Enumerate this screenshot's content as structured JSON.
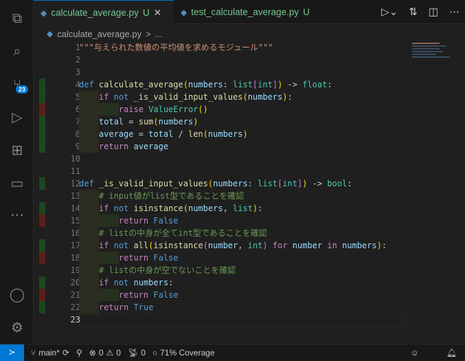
{
  "tabs": [
    {
      "label": "calculate_average.py",
      "status": "U",
      "active": true
    },
    {
      "label": "test_calculate_average.py",
      "status": "U",
      "active": false
    }
  ],
  "breadcrumb": {
    "file": "calculate_average.py",
    "sep": ">",
    "rest": "..."
  },
  "scm_badge": "23",
  "lines": [
    {
      "n": 1,
      "cov": "",
      "tokens": [
        [
          "\"\"\"与えられた数値の平均値を求めるモジュール\"\"\"",
          "s"
        ]
      ]
    },
    {
      "n": 2,
      "cov": "",
      "tokens": []
    },
    {
      "n": 3,
      "cov": "",
      "tokens": []
    },
    {
      "n": 4,
      "cov": "g",
      "tokens": [
        [
          "def ",
          "k"
        ],
        [
          "calculate_average",
          "f"
        ],
        [
          "(",
          "y"
        ],
        [
          "numbers",
          "v"
        ],
        [
          ": ",
          "p"
        ],
        [
          "list",
          "t"
        ],
        [
          "[",
          "pk"
        ],
        [
          "int",
          "t"
        ],
        [
          "]",
          "pk"
        ],
        [
          ")",
          "y"
        ],
        [
          " -> ",
          "p"
        ],
        [
          "float",
          "t"
        ],
        [
          ":",
          "p"
        ]
      ]
    },
    {
      "n": 5,
      "cov": "g",
      "tokens": [
        [
          "    ",
          "p"
        ],
        [
          "if ",
          "c"
        ],
        [
          "not ",
          "k"
        ],
        [
          "_is_valid_input_values",
          "f"
        ],
        [
          "(",
          "y"
        ],
        [
          "numbers",
          "v"
        ],
        [
          ")",
          "y"
        ],
        [
          ":",
          "p"
        ]
      ]
    },
    {
      "n": 6,
      "cov": "r",
      "tokens": [
        [
          "        ",
          "p"
        ],
        [
          "raise ",
          "c"
        ],
        [
          "ValueError",
          "t"
        ],
        [
          "()",
          "y"
        ]
      ]
    },
    {
      "n": 7,
      "cov": "g",
      "tokens": [
        [
          "    ",
          "p"
        ],
        [
          "total",
          "v"
        ],
        [
          " = ",
          "p"
        ],
        [
          "sum",
          "f"
        ],
        [
          "(",
          "y"
        ],
        [
          "numbers",
          "v"
        ],
        [
          ")",
          "y"
        ]
      ]
    },
    {
      "n": 8,
      "cov": "g",
      "tokens": [
        [
          "    ",
          "p"
        ],
        [
          "average",
          "v"
        ],
        [
          " = ",
          "p"
        ],
        [
          "total",
          "v"
        ],
        [
          " / ",
          "p"
        ],
        [
          "len",
          "f"
        ],
        [
          "(",
          "y"
        ],
        [
          "numbers",
          "v"
        ],
        [
          ")",
          "y"
        ]
      ]
    },
    {
      "n": 9,
      "cov": "g",
      "tokens": [
        [
          "    ",
          "p"
        ],
        [
          "return ",
          "c"
        ],
        [
          "average",
          "v"
        ]
      ]
    },
    {
      "n": 10,
      "cov": "",
      "tokens": []
    },
    {
      "n": 11,
      "cov": "",
      "tokens": []
    },
    {
      "n": 12,
      "cov": "g",
      "tokens": [
        [
          "def ",
          "k"
        ],
        [
          "_is_valid_input_values",
          "f"
        ],
        [
          "(",
          "y"
        ],
        [
          "numbers",
          "v"
        ],
        [
          ": ",
          "p"
        ],
        [
          "list",
          "t"
        ],
        [
          "[",
          "pk"
        ],
        [
          "int",
          "t"
        ],
        [
          "]",
          "pk"
        ],
        [
          ")",
          "y"
        ],
        [
          " -> ",
          "p"
        ],
        [
          "bool",
          "t"
        ],
        [
          ":",
          "p"
        ]
      ]
    },
    {
      "n": 13,
      "cov": "",
      "tokens": [
        [
          "    ",
          "p"
        ],
        [
          "# input値がlist型であることを確認",
          "m"
        ]
      ]
    },
    {
      "n": 14,
      "cov": "g",
      "tokens": [
        [
          "    ",
          "p"
        ],
        [
          "if ",
          "c"
        ],
        [
          "not ",
          "k"
        ],
        [
          "isinstance",
          "f"
        ],
        [
          "(",
          "y"
        ],
        [
          "numbers",
          "v"
        ],
        [
          ", ",
          "p"
        ],
        [
          "list",
          "t"
        ],
        [
          ")",
          "y"
        ],
        [
          ":",
          "p"
        ]
      ]
    },
    {
      "n": 15,
      "cov": "r",
      "tokens": [
        [
          "        ",
          "p"
        ],
        [
          "return ",
          "c"
        ],
        [
          "False",
          "k"
        ]
      ]
    },
    {
      "n": 16,
      "cov": "",
      "tokens": [
        [
          "    ",
          "p"
        ],
        [
          "# listの中身が全てint型であることを確認",
          "m"
        ]
      ]
    },
    {
      "n": 17,
      "cov": "g",
      "tokens": [
        [
          "    ",
          "p"
        ],
        [
          "if ",
          "c"
        ],
        [
          "not ",
          "k"
        ],
        [
          "all",
          "f"
        ],
        [
          "(",
          "y"
        ],
        [
          "isinstance",
          "f"
        ],
        [
          "(",
          "pk"
        ],
        [
          "number",
          "v"
        ],
        [
          ", ",
          "p"
        ],
        [
          "int",
          "t"
        ],
        [
          ")",
          "pk"
        ],
        [
          " for ",
          "c"
        ],
        [
          "number",
          "v"
        ],
        [
          " in ",
          "c"
        ],
        [
          "numbers",
          "v"
        ],
        [
          ")",
          "y"
        ],
        [
          ":",
          "p"
        ]
      ]
    },
    {
      "n": 18,
      "cov": "r",
      "tokens": [
        [
          "        ",
          "p"
        ],
        [
          "return ",
          "c"
        ],
        [
          "False",
          "k"
        ]
      ]
    },
    {
      "n": 19,
      "cov": "",
      "tokens": [
        [
          "    ",
          "p"
        ],
        [
          "# listの中身が空でないことを確認",
          "m"
        ]
      ]
    },
    {
      "n": 20,
      "cov": "g",
      "tokens": [
        [
          "    ",
          "p"
        ],
        [
          "if ",
          "c"
        ],
        [
          "not ",
          "k"
        ],
        [
          "numbers",
          "v"
        ],
        [
          ":",
          "p"
        ]
      ]
    },
    {
      "n": 21,
      "cov": "r",
      "tokens": [
        [
          "        ",
          "p"
        ],
        [
          "return ",
          "c"
        ],
        [
          "False",
          "k"
        ]
      ]
    },
    {
      "n": 22,
      "cov": "g",
      "tokens": [
        [
          "    ",
          "p"
        ],
        [
          "return ",
          "c"
        ],
        [
          "True",
          "k"
        ]
      ]
    },
    {
      "n": 23,
      "cov": "",
      "tokens": []
    }
  ],
  "status": {
    "branch": "main*",
    "errors": "0",
    "warnings": "0",
    "ports": "0",
    "coverage": "71% Coverage"
  }
}
